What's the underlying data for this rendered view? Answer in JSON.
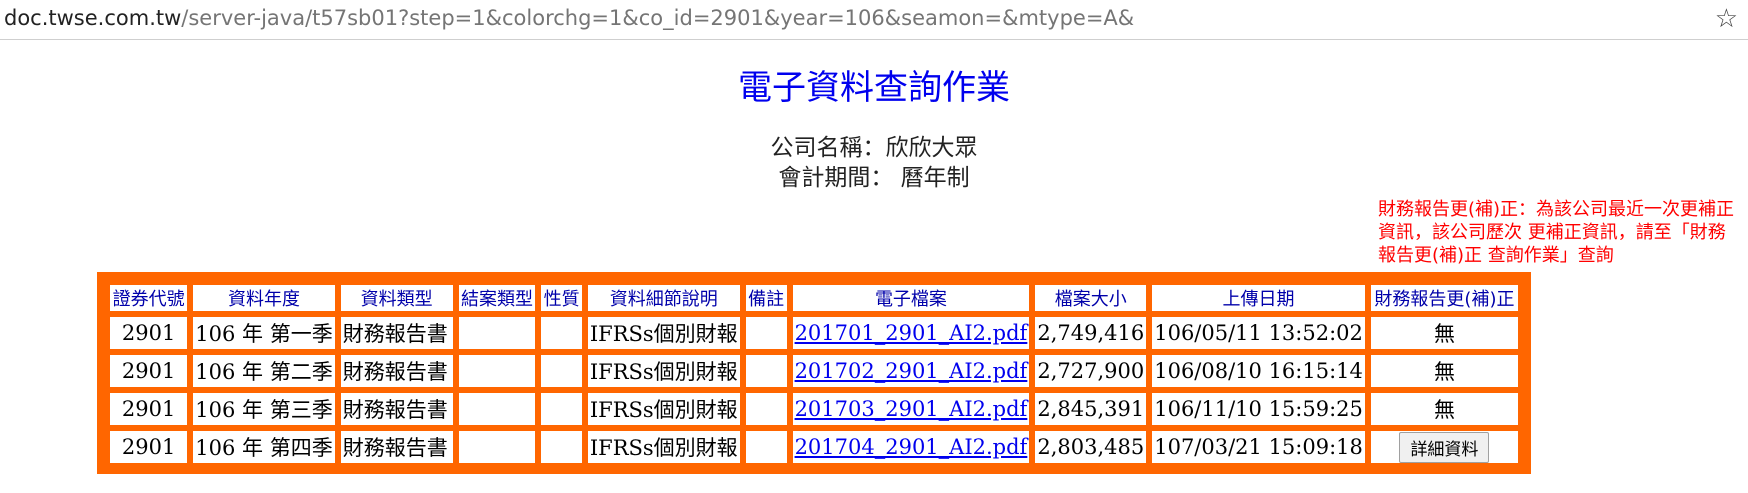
{
  "browser": {
    "url_host": "doc.twse.com.tw",
    "url_path": "/server-java/t57sb01?step=1&colorchg=1&co_id=2901&year=106&seamon=&mtype=A&",
    "bookmark_icon": "star-icon"
  },
  "page": {
    "title": "電子資料查詢作業",
    "company_line": "公司名稱：欣欣大眾",
    "period_line": "會計期間： 曆年制",
    "note": "財務報告更(補)正：為該公司最近一次更補正資訊，該公司歷次 更補正資訊，請至「財務報告更(補)正 查詢作業」查詢"
  },
  "table": {
    "headers": [
      "證券代號",
      "資料年度",
      "資料類型",
      "結案類型",
      "性質",
      "資料細節說明",
      "備註",
      "電子檔案",
      "檔案大小",
      "上傳日期",
      "財務報告更(補)正"
    ],
    "rows": [
      {
        "code": "2901",
        "year": "106 年 第一季",
        "type": "財務報告書",
        "case_type": "",
        "nature": "",
        "detail": "IFRSs個別財報",
        "remark": "",
        "file": "201701_2901_AI2.pdf",
        "size": "2,749,416",
        "uploaded": "106/05/11 13:52:02",
        "correction": "無"
      },
      {
        "code": "2901",
        "year": "106 年 第二季",
        "type": "財務報告書",
        "case_type": "",
        "nature": "",
        "detail": "IFRSs個別財報",
        "remark": "",
        "file": "201702_2901_AI2.pdf",
        "size": "2,727,900",
        "uploaded": "106/08/10 16:15:14",
        "correction": "無"
      },
      {
        "code": "2901",
        "year": "106 年 第三季",
        "type": "財務報告書",
        "case_type": "",
        "nature": "",
        "detail": "IFRSs個別財報",
        "remark": "",
        "file": "201703_2901_AI2.pdf",
        "size": "2,845,391",
        "uploaded": "106/11/10 15:59:25",
        "correction": "無"
      },
      {
        "code": "2901",
        "year": "106 年 第四季",
        "type": "財務報告書",
        "case_type": "",
        "nature": "",
        "detail": "IFRSs個別財報",
        "remark": "",
        "file": "201704_2901_AI2.pdf",
        "size": "2,803,485",
        "uploaded": "107/03/21 15:09:18",
        "correction": "詳細資料"
      }
    ]
  },
  "colors": {
    "frame": "#ff6600",
    "title": "#0000ee",
    "header_text": "#0000aa",
    "note": "#ff0000"
  }
}
